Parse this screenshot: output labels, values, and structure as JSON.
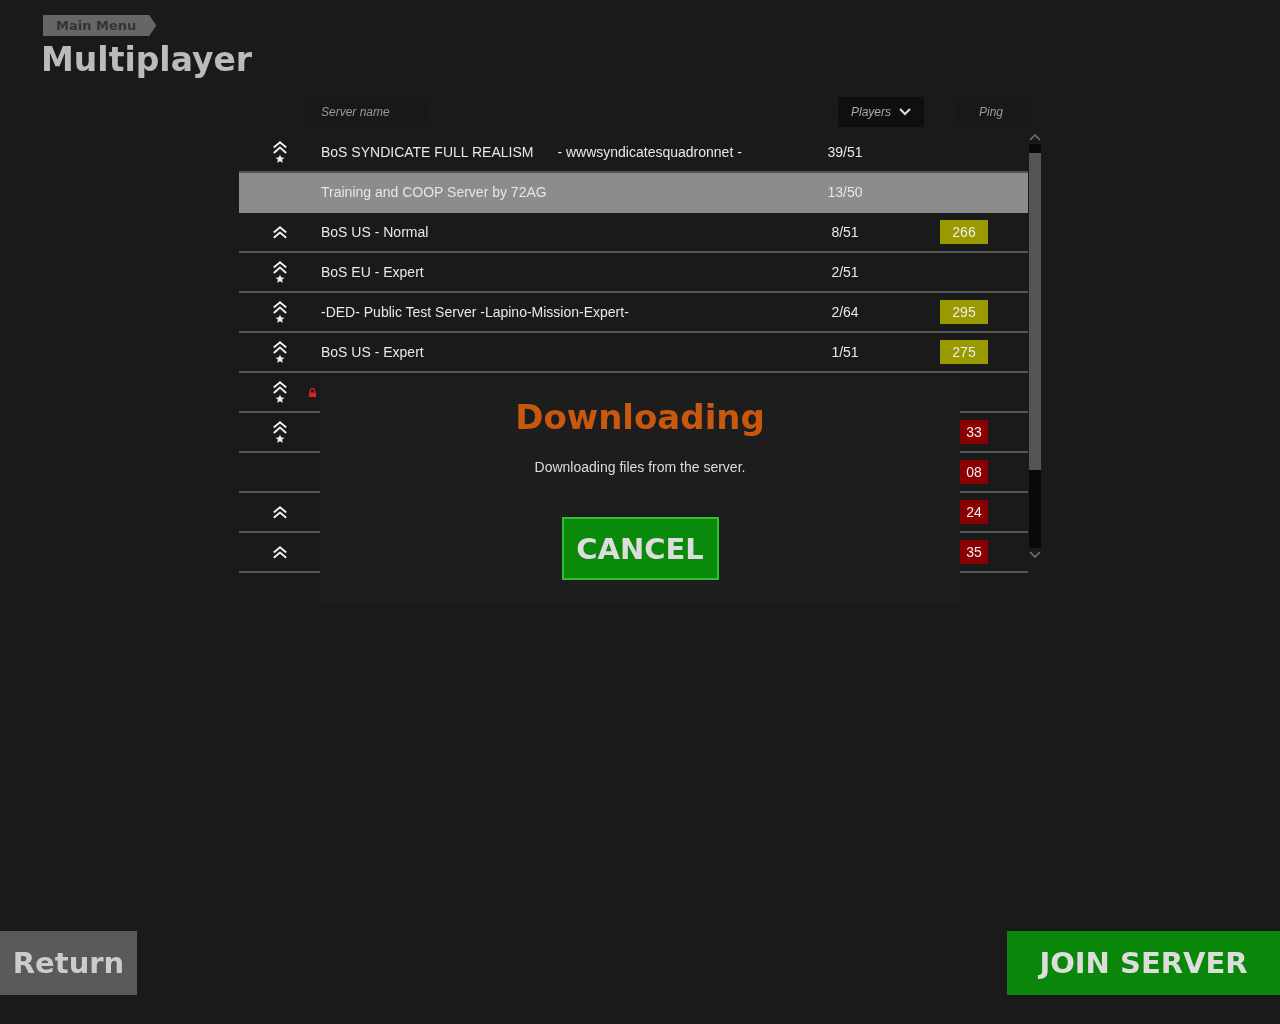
{
  "breadcrumb": "Main Menu",
  "title": "Multiplayer",
  "columns": {
    "name": "Server name",
    "players": "Players",
    "ping": "Ping"
  },
  "servers": [
    {
      "kind": "star",
      "locked": false,
      "selected": false,
      "name": "BoS SYNDICATE FULL REALISM",
      "extra": "- wwwsyndicatesquadronnet -",
      "players": "39/51"
    },
    {
      "kind": "none",
      "locked": false,
      "selected": true,
      "name": "Training and COOP Server by 72AG",
      "players": "13/50"
    },
    {
      "kind": "plain",
      "locked": false,
      "selected": false,
      "name": "BoS US - Normal",
      "players": "8/51",
      "ping": {
        "text": "266",
        "color": "#999900"
      }
    },
    {
      "kind": "star",
      "locked": false,
      "selected": false,
      "name": "BoS EU - Expert",
      "players": "2/51"
    },
    {
      "kind": "star",
      "locked": false,
      "selected": false,
      "name": "-DED- Public Test Server -Lapino-Mission-Expert-",
      "players": "2/64",
      "ping": {
        "text": "295",
        "color": "#999900"
      }
    },
    {
      "kind": "star",
      "locked": false,
      "selected": false,
      "name": "BoS US - Expert",
      "players": "1/51",
      "ping": {
        "text": "275",
        "color": "#999900"
      }
    },
    {
      "kind": "star",
      "locked": true,
      "selected": false
    },
    {
      "kind": "star",
      "locked": false,
      "selected": false,
      "ping": {
        "text": "33",
        "color": "#8b0000"
      }
    },
    {
      "kind": "none",
      "locked": false,
      "selected": false,
      "ping": {
        "text": "08",
        "color": "#8b0000"
      }
    },
    {
      "kind": "plain",
      "locked": false,
      "selected": false,
      "ping": {
        "text": "24",
        "color": "#8b0000"
      }
    },
    {
      "kind": "plain",
      "locked": false,
      "selected": false,
      "ping": {
        "text": "35",
        "color": "#8b0000"
      }
    }
  ],
  "dialog": {
    "title": "Downloading",
    "message": "Downloading files from the server.",
    "button": "CANCEL"
  },
  "buttons": {
    "return": "Return",
    "join": "JOIN SERVER"
  }
}
